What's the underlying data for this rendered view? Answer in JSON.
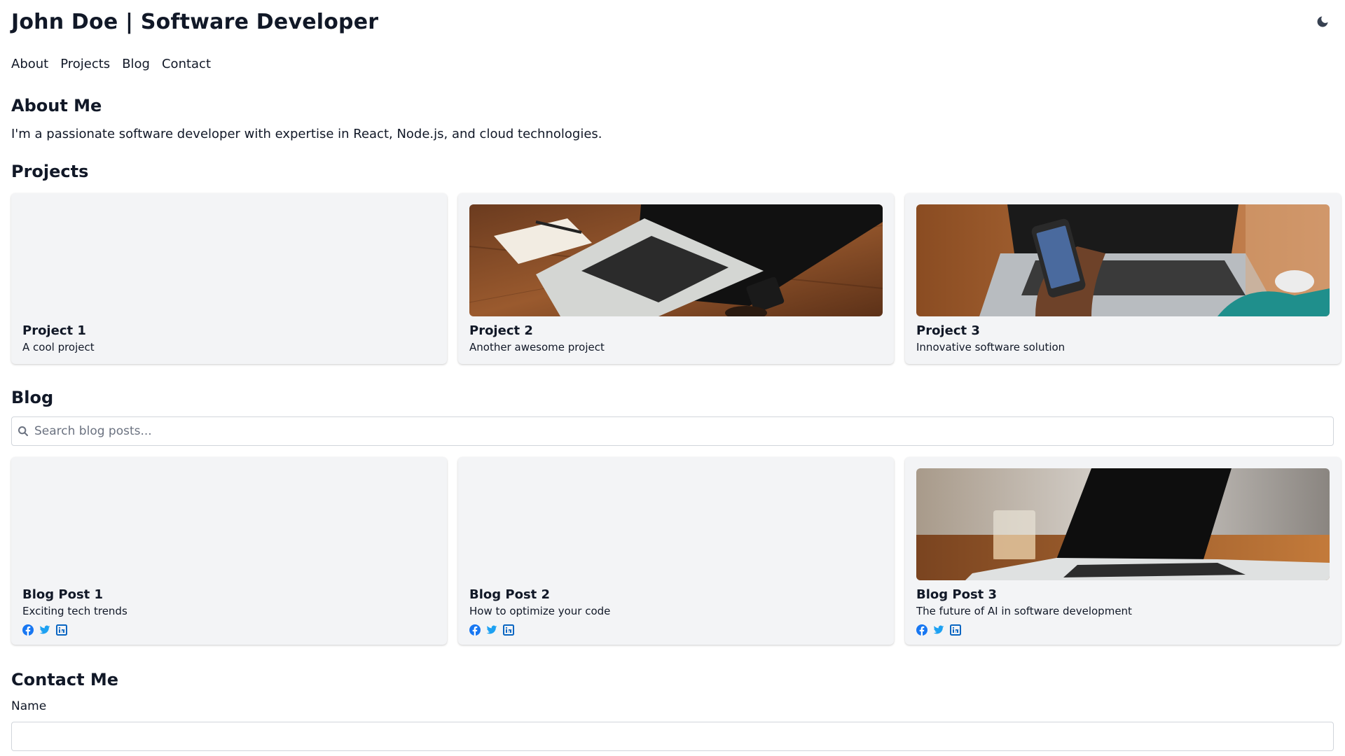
{
  "header": {
    "title": "John Doe | Software Developer",
    "theme_icon": "moon-icon"
  },
  "nav": {
    "items": [
      {
        "label": "About"
      },
      {
        "label": "Projects"
      },
      {
        "label": "Blog"
      },
      {
        "label": "Contact"
      }
    ]
  },
  "about": {
    "title": "About Me",
    "text": "I'm a passionate software developer with expertise in React, Node.js, and cloud technologies."
  },
  "projects": {
    "title": "Projects",
    "items": [
      {
        "title": "Project 1",
        "description": "A cool project"
      },
      {
        "title": "Project 2",
        "description": "Another awesome project"
      },
      {
        "title": "Project 3",
        "description": "Innovative software solution"
      }
    ]
  },
  "blog": {
    "title": "Blog",
    "search_placeholder": "Search blog posts...",
    "search_value": "",
    "share_icons": [
      "facebook-icon",
      "twitter-icon",
      "linkedin-icon"
    ],
    "posts": [
      {
        "title": "Blog Post 1",
        "excerpt": "Exciting tech trends"
      },
      {
        "title": "Blog Post 2",
        "excerpt": "How to optimize your code"
      },
      {
        "title": "Blog Post 3",
        "excerpt": "The future of AI in software development"
      }
    ]
  },
  "contact": {
    "title": "Contact Me",
    "name_label": "Name",
    "name_value": ""
  },
  "colors": {
    "card_bg": "#f3f4f6",
    "facebook": "#1877f2",
    "twitter": "#1da1f2",
    "linkedin": "#0a66c2",
    "text": "#111827"
  }
}
